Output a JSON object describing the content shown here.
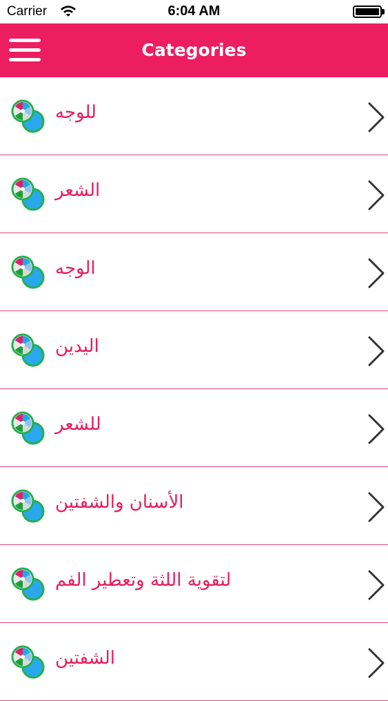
{
  "status_bar": {
    "carrier": "Carrier",
    "time": "6:04 AM",
    "battery_level": 1.0
  },
  "nav_bar": {
    "title": "Categories",
    "menu_icon": "hamburger-menu-icon",
    "color": "#ec1d60"
  },
  "categories": [
    {
      "label": "للوجه",
      "icon": "category-icon",
      "chevron": "chevron-right-icon"
    },
    {
      "label": "الشعر",
      "icon": "category-icon",
      "chevron": "chevron-right-icon"
    },
    {
      "label": "الوجه",
      "icon": "category-icon",
      "chevron": "chevron-right-icon"
    },
    {
      "label": "اليدين",
      "icon": "category-icon",
      "chevron": "chevron-right-icon"
    },
    {
      "label": "للشعر",
      "icon": "category-icon",
      "chevron": "chevron-right-icon"
    },
    {
      "label": "الأسنان والشفتين",
      "icon": "category-icon",
      "chevron": "chevron-right-icon"
    },
    {
      "label": "لتقوية اللثة وتعطير الفم",
      "icon": "category-icon",
      "chevron": "chevron-right-icon"
    },
    {
      "label": "الشفتين",
      "icon": "category-icon",
      "chevron": "chevron-right-icon"
    }
  ],
  "colors": {
    "accent": "#ec1d60",
    "label_text": "#e81c5b",
    "separator": "#e0447a"
  }
}
